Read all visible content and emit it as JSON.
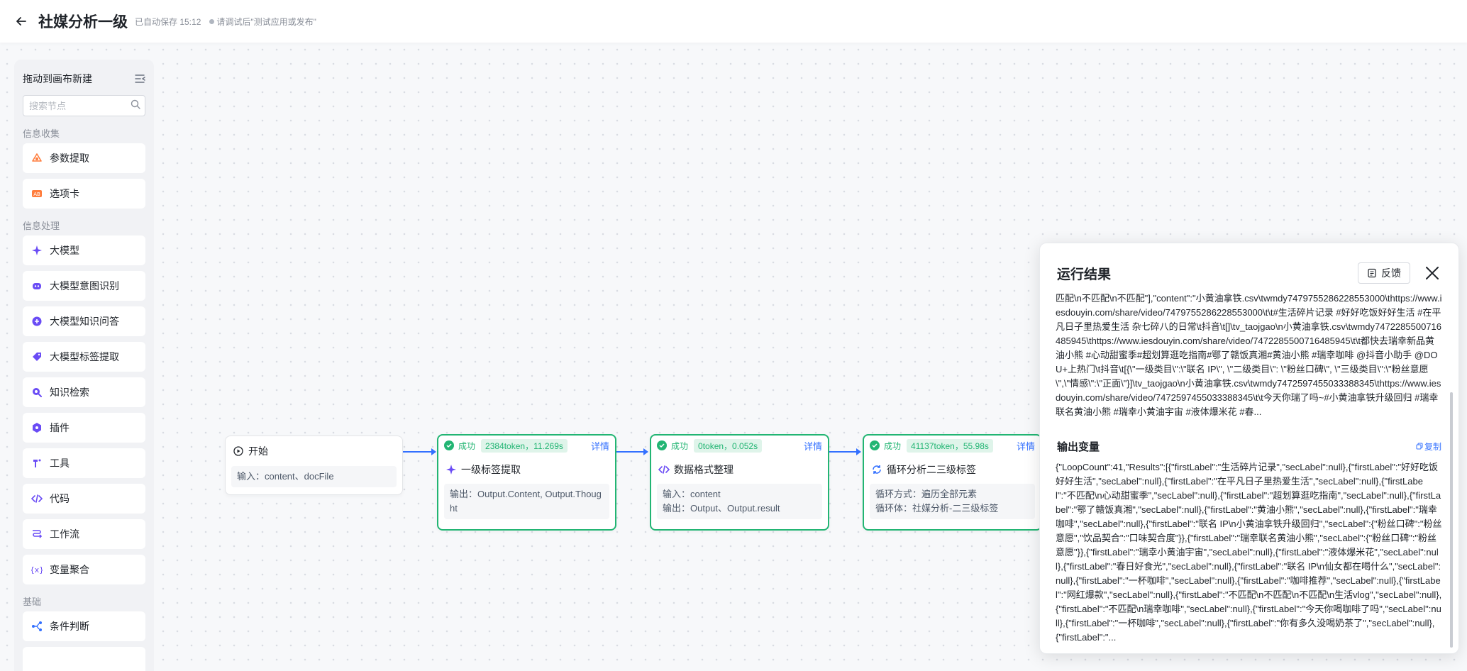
{
  "header": {
    "title": "社媒分析一级",
    "save_status": "已自动保存 15:12",
    "hint": "请调试后\"测试应用或发布\""
  },
  "sidebar": {
    "title": "拖动到画布新建",
    "search_placeholder": "搜索节点",
    "groups": [
      {
        "label": "信息收集",
        "items": [
          {
            "label": "参数提取",
            "icon": "param-extract-icon",
            "color": "#ff7d3d"
          },
          {
            "label": "选项卡",
            "icon": "option-card-icon",
            "color": "#ff7d3d"
          }
        ]
      },
      {
        "label": "信息处理",
        "items": [
          {
            "label": "大模型",
            "icon": "llm-sparkle-icon",
            "color": "#6a4cf5"
          },
          {
            "label": "大模型意图识别",
            "icon": "intent-robot-icon",
            "color": "#6a4cf5"
          },
          {
            "label": "大模型知识问答",
            "icon": "knowledge-qa-icon",
            "color": "#6a4cf5"
          },
          {
            "label": "大模型标签提取",
            "icon": "tag-icon",
            "color": "#6a4cf5"
          },
          {
            "label": "知识检索",
            "icon": "knowledge-search-icon",
            "color": "#6a4cf5"
          },
          {
            "label": "插件",
            "icon": "plugin-hex-icon",
            "color": "#6a4cf5"
          },
          {
            "label": "工具",
            "icon": "tool-icon",
            "color": "#6a4cf5"
          },
          {
            "label": "代码",
            "icon": "code-icon",
            "color": "#6a4cf5"
          },
          {
            "label": "工作流",
            "icon": "workflow-icon",
            "color": "#6a4cf5"
          },
          {
            "label": "变量聚合",
            "icon": "variable-aggregate-icon",
            "color": "#6a4cf5"
          }
        ]
      },
      {
        "label": "基础",
        "items": [
          {
            "label": "条件判断",
            "icon": "condition-branch-icon",
            "color": "#3370ff"
          }
        ]
      }
    ]
  },
  "canvas": {
    "start_node": {
      "title": "开始",
      "body": "输入：content、docFile"
    },
    "nodes": [
      {
        "status": "成功",
        "metric": "2384token，11.269s",
        "detail": "详情",
        "title": "一级标签提取",
        "body": [
          "输出：Output.Content, Output.Thought"
        ]
      },
      {
        "status": "成功",
        "metric": "0token，0.052s",
        "detail": "详情",
        "title": "数据格式整理",
        "body": [
          "输入：content",
          "输出：Output、Output.result"
        ]
      },
      {
        "status": "成功",
        "metric": "41137token，55.98s",
        "detail": "详情",
        "title": "循环分析二三级标签",
        "body": [
          "循环方式：遍历全部元素",
          "循环体：社媒分析-二三级标签"
        ]
      }
    ]
  },
  "result_panel": {
    "title": "运行结果",
    "feedback_label": "反馈",
    "output_text": "匹配\\n不匹配\\n不匹配\"],\"content\":\"小黄油拿铁.csv\\twmdy7479755286228553000\\thttps://www.iesdouyin.com/share/video/7479755286228553000\\t\\t#生活碎片记录 #好好吃饭好好生活 #在平凡日子里热爱生活 杂七碎八的日常\\t抖音\\t[]\\tv_taojgao\\n小黄油拿铁.csv\\twmdy7472285500716485945\\thttps://www.iesdouyin.com/share/video/7472285500716485945\\t\\t都快去瑞幸新品黄油小熊 #心动甜蜜季#超划算逛吃指南#鄂了赣饭真湘#黄油小熊 #瑞幸咖啡 @抖音小助手 @DOU+上热门\\t抖音\\t[{\\\"一级类目\\\":\\\"联名 IP\\\", \\\"二级类目\\\": \\\"粉丝口碑\\\", \\\"三级类目\\\":\\\"粉丝意愿\\\",\\\"情感\\\":\\\"正面\\\"}]\\tv_taojgao\\n小黄油拿铁.csv\\twmdy7472597455033388345\\thttps://www.iesdouyin.com/share/video/7472597455033388345\\t\\t今天你瑞了吗~#小黄油拿铁升级回归 #瑞幸联名黄油小熊 #瑞幸小黄油宇宙 #液体爆米花 #春...",
    "vars_title": "输出变量",
    "copy_label": "复制",
    "vars_text": "{\"LoopCount\":41,\"Results\":[{\"firstLabel\":\"生活碎片记录\",\"secLabel\":null},{\"firstLabel\":\"好好吃饭好好生活\",\"secLabel\":null},{\"firstLabel\":\"在平凡日子里热爱生活\",\"secLabel\":null},{\"firstLabel\":\"不匹配\\n心动甜蜜季\",\"secLabel\":null},{\"firstLabel\":\"超划算逛吃指南\",\"secLabel\":null},{\"firstLabel\":\"鄂了赣饭真湘\",\"secLabel\":null},{\"firstLabel\":\"黄油小熊\",\"secLabel\":null},{\"firstLabel\":\"瑞幸咖啡\",\"secLabel\":null},{\"firstLabel\":\"联名 IP\\n小黄油拿铁升级回归\",\"secLabel\":{\"粉丝口碑\":\"粉丝意愿\",\"饮品契合\":\"口味契合度\"}},{\"firstLabel\":\"瑞幸联名黄油小熊\",\"secLabel\":{\"粉丝口碑\":\"粉丝意愿\"}},{\"firstLabel\":\"瑞幸小黄油宇宙\",\"secLabel\":null},{\"firstLabel\":\"液体爆米花\",\"secLabel\":null},{\"firstLabel\":\"春日好食光\",\"secLabel\":null},{\"firstLabel\":\"联名 IP\\n仙女都在喝什么\",\"secLabel\":null},{\"firstLabel\":\"一杯咖啡\",\"secLabel\":null},{\"firstLabel\":\"咖啡推荐\",\"secLabel\":null},{\"firstLabel\":\"网红爆款\",\"secLabel\":null},{\"firstLabel\":\"不匹配\\n不匹配\\n不匹配\\n生活vlog\",\"secLabel\":null},{\"firstLabel\":\"不匹配\\n瑞幸咖啡\",\"secLabel\":null},{\"firstLabel\":\"今天你喝咖啡了吗\",\"secLabel\":null},{\"firstLabel\":\"一杯咖啡\",\"secLabel\":null},{\"firstLabel\":\"你有多久没喝奶茶了\",\"secLabel\":null},{\"firstLabel\":\"..."
  }
}
